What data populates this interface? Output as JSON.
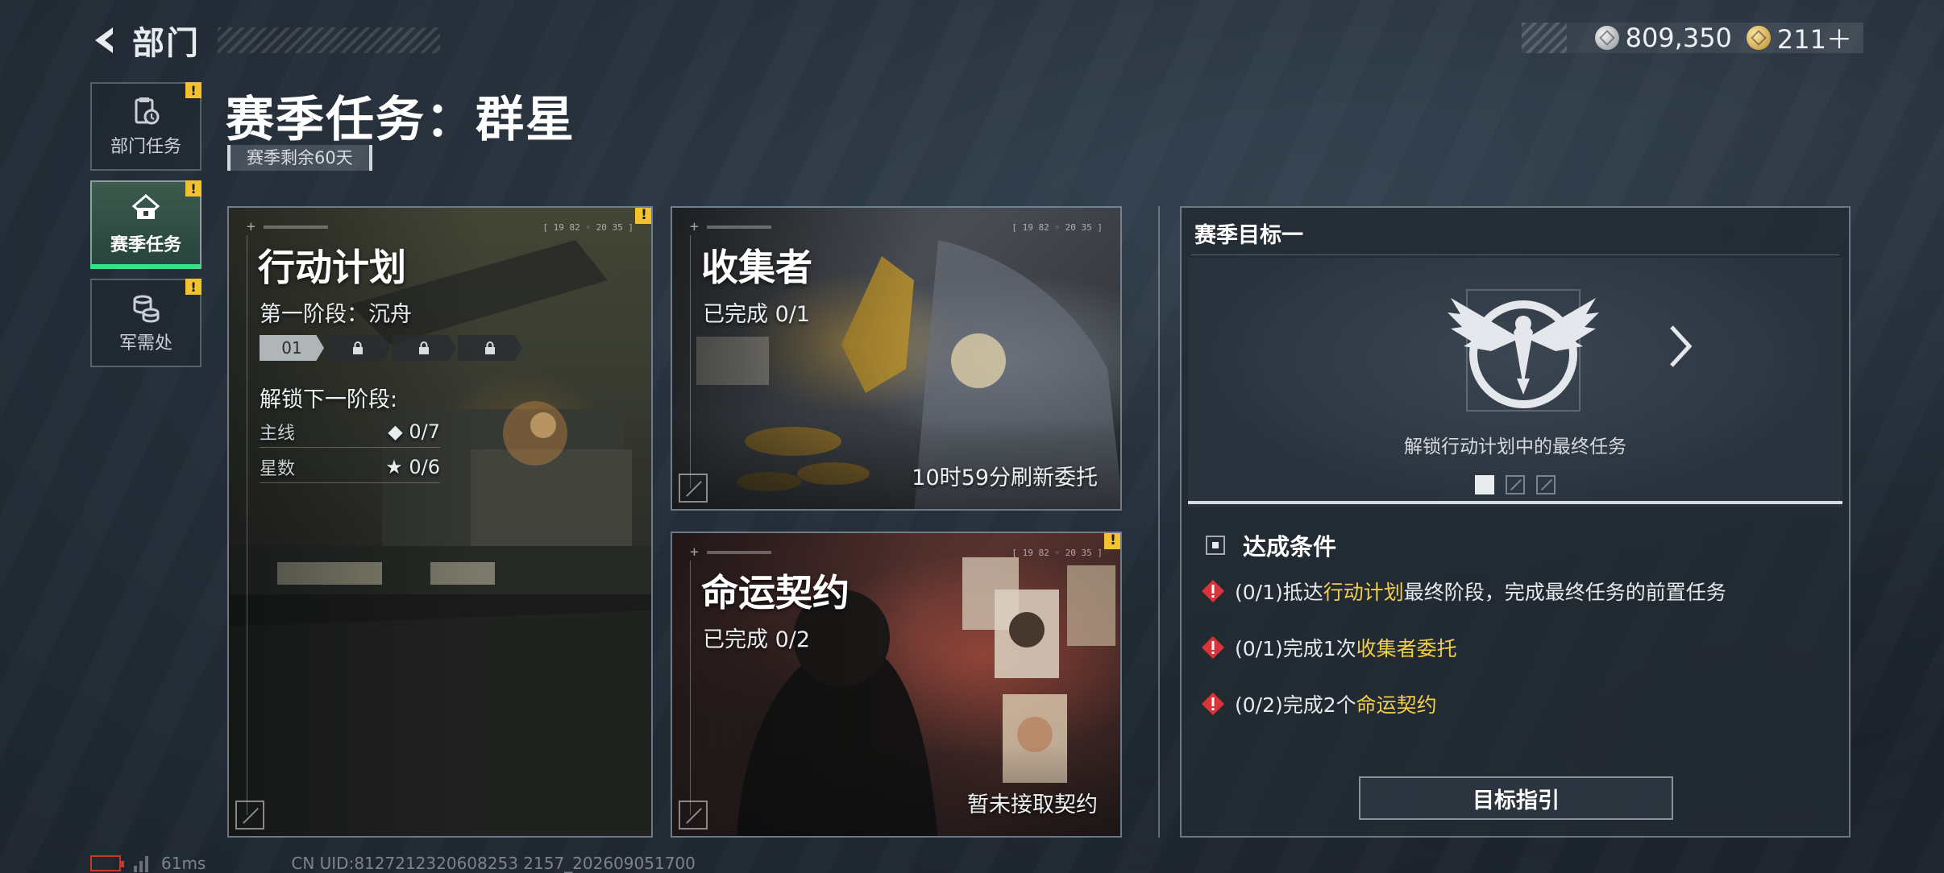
{
  "header": {
    "back_label": "部门",
    "currencies": [
      {
        "icon": "silver-coin-icon",
        "value": "809,350"
      },
      {
        "icon": "gold-coin-icon",
        "value": "211＋"
      }
    ]
  },
  "side_nav": {
    "items": [
      {
        "label": "部门任务",
        "icon": "clipboard-icon",
        "active": false,
        "alert": "!"
      },
      {
        "label": "赛季任务",
        "icon": "season-badge-icon",
        "active": true,
        "alert": "!"
      },
      {
        "label": "军需处",
        "icon": "coin-stack-icon",
        "active": false,
        "alert": "!"
      }
    ]
  },
  "page": {
    "title": "赛季任务：群星",
    "remaining": "赛季剩余60天"
  },
  "cards": {
    "action_plan": {
      "hud_time": "[ 19 82 ◦ 20 35 ]",
      "alert": "!",
      "title": "行动计划",
      "stage": "第一阶段：沉舟",
      "stages": [
        "01"
      ],
      "unlock_label": "解锁下一阶段:",
      "requirements": [
        {
          "label": "主线",
          "value": "◆ 0/7"
        },
        {
          "label": "星数",
          "value": "★ 0/6"
        }
      ]
    },
    "collector": {
      "hud_time": "[ 19 82 ◦ 20 35 ]",
      "title": "收集者",
      "progress": "已完成 0/1",
      "footer": "10时59分刷新委托"
    },
    "fate_contract": {
      "hud_time": "[ 19 82 ◦ 20 35 ]",
      "alert": "!",
      "title": "命运契约",
      "progress": "已完成 0/2",
      "footer": "暂未接取契约"
    }
  },
  "goal": {
    "header": "赛季目标一",
    "caption": "解锁行动计划中的最终任务",
    "pager_count": 3,
    "pager_active": 0,
    "conditions_title": "达成条件",
    "conditions": [
      {
        "prefix": "(0/1)抵达",
        "highlight": "行动计划",
        "suffix": "最终阶段，完成最终任务的前置任务"
      },
      {
        "prefix": "(0/1)完成1次",
        "highlight": "收集者委托",
        "suffix": ""
      },
      {
        "prefix": "(0/2)完成2个",
        "highlight": "命运契约",
        "suffix": ""
      }
    ],
    "guide_button": "目标指引"
  },
  "footer": {
    "ping": "61ms",
    "uid": "CN UID:8127212320608253 2157_202609051700"
  },
  "colors": {
    "accent_green": "#3fdc8a",
    "alert_yellow": "#f2c230",
    "highlight_yellow": "#f2cf4a",
    "alert_red": "#d8343a"
  }
}
